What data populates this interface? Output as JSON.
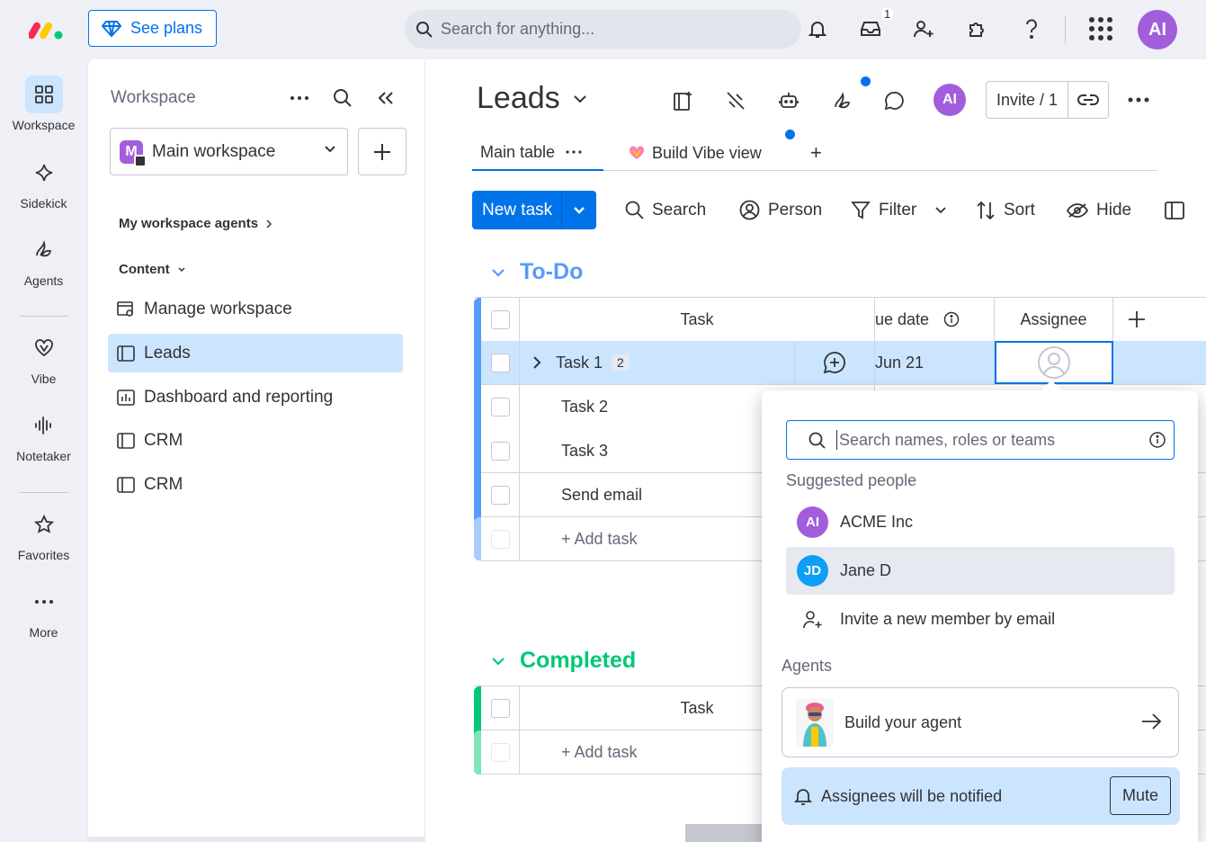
{
  "topbar": {
    "see_plans": "See plans",
    "search_placeholder": "Search for anything...",
    "inbox_count": "1",
    "avatar": "AI"
  },
  "rail": {
    "items": [
      {
        "label": "Workspace",
        "icon": "grid-icon"
      },
      {
        "label": "Sidekick",
        "icon": "sparkle-icon"
      },
      {
        "label": "Agents",
        "icon": "agents-icon"
      },
      {
        "label": "Vibe",
        "icon": "vibe-heart-icon"
      },
      {
        "label": "Notetaker",
        "icon": "waveform-icon"
      },
      {
        "label": "Favorites",
        "icon": "star-icon"
      },
      {
        "label": "More",
        "icon": "dots-icon"
      }
    ]
  },
  "workspace": {
    "title": "Workspace",
    "selected": "Main workspace",
    "workspace_initial": "M",
    "agents_link": "My workspace agents",
    "content_label": "Content",
    "items": [
      {
        "label": "Manage workspace"
      },
      {
        "label": "Leads"
      },
      {
        "label": "Dashboard and reporting"
      },
      {
        "label": "CRM"
      },
      {
        "label": "CRM"
      }
    ]
  },
  "board": {
    "title": "Leads",
    "avatar": "AI",
    "invite_label": "Invite / 1",
    "tabs": {
      "main": "Main table",
      "vibe": "Build Vibe view",
      "add": "+"
    },
    "toolbar": {
      "new_task": "New task",
      "search": "Search",
      "person": "Person",
      "filter": "Filter",
      "sort": "Sort",
      "hide": "Hide"
    },
    "groups": {
      "todo": {
        "title": "To-Do",
        "color": "#579bfc",
        "columns": {
          "task": "Task",
          "due": "ue date",
          "assignee": "Assignee"
        },
        "rows": [
          {
            "name": "Task 1",
            "subitems": "2",
            "due": "Jun 21"
          },
          {
            "name": "Task 2"
          },
          {
            "name": "Task 3"
          },
          {
            "name": "Send email"
          }
        ],
        "add_task": "+ Add task"
      },
      "completed": {
        "title": "Completed",
        "color": "#00c875",
        "columns": {
          "task": "Task"
        },
        "add_task": "+ Add task"
      }
    }
  },
  "popup": {
    "search_placeholder": "Search names, roles or teams",
    "suggested_label": "Suggested people",
    "people": [
      {
        "initials": "AI",
        "name": "ACME Inc",
        "color": "#a25ddc"
      },
      {
        "initials": "JD",
        "name": "Jane D",
        "color": "#0d9ff5"
      }
    ],
    "invite_email": "Invite a new member by email",
    "agents_label": "Agents",
    "build_agent": "Build your agent",
    "notify_text": "Assignees will be notified",
    "mute": "Mute"
  }
}
